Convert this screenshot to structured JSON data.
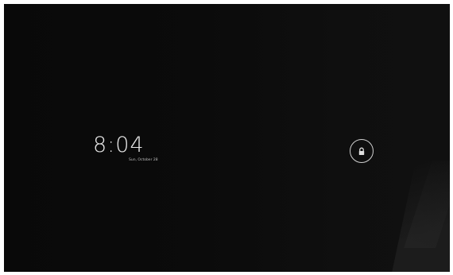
{
  "lockscreen": {
    "time": "8:04",
    "date": "Sun, October 28",
    "unlock_icon": "lock-icon"
  },
  "colors": {
    "background": "#0b0b0b",
    "clock_text": "#e6e6e6",
    "ring": "#d0d0d0"
  }
}
